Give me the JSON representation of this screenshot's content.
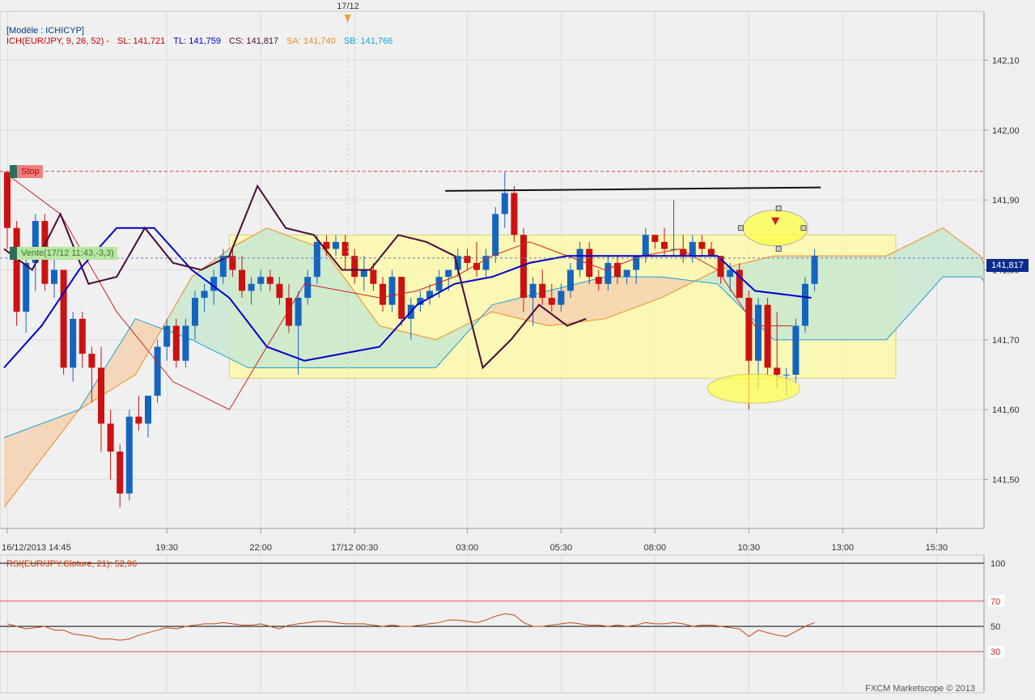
{
  "header": {
    "model": "[Modèle : ICHICYP]",
    "indicator": "ICH(EUR/JPY, 9, 26, 52) -",
    "sl": "SL: 141,721",
    "tl": "TL: 141,759",
    "cs": "CS: 141,817",
    "sa": "SA: 141,740",
    "sb": "SB: 141,766"
  },
  "top_marker": "17/12",
  "price_tag": "141,817",
  "stop_label": "Stop",
  "vente_label": "Vente(17/12 11:43,-3,3)",
  "rsi_label": "RSI(EUR/JPY.Cloture, 21): 52,96",
  "copyright": "FXCM Marketscope © 2013",
  "colors": {
    "bull": "#1565c0",
    "bear": "#cc1111",
    "tenkan": "#cc2222",
    "kijun": "#0000cc",
    "chikou": "#4a0a3a",
    "span_a": "#f08a24",
    "span_b": "#1aa0d8",
    "kumo_bull": "#c8e8d0",
    "kumo_bear": "#f5d2b0",
    "rect_fill": "#fffaa0"
  },
  "chart_data": [
    {
      "type": "candlestick",
      "title": "EUR/JPY",
      "x_ticks": [
        "16/12/2013 14:45",
        "19:30",
        "22:00",
        "17/12 00:30",
        "03:00",
        "05:30",
        "08:00",
        "10:30",
        "13:00",
        "15:30"
      ],
      "y_ticks": [
        "142,10",
        "142,00",
        "141,90",
        "141,80",
        "141,70",
        "141,60",
        "141,50"
      ],
      "ylim": [
        141.43,
        142.17
      ],
      "current_price": 141.817,
      "stop_level": 141.941,
      "candles": [
        [
          141.94,
          141.94,
          141.83,
          141.86
        ],
        [
          141.86,
          141.87,
          141.72,
          141.74
        ],
        [
          141.74,
          141.82,
          141.71,
          141.81
        ],
        [
          141.81,
          141.88,
          141.77,
          141.87
        ],
        [
          141.87,
          141.88,
          141.77,
          141.78
        ],
        [
          141.78,
          141.82,
          141.76,
          141.8
        ],
        [
          141.8,
          141.8,
          141.65,
          141.66
        ],
        [
          141.66,
          141.74,
          141.64,
          141.73
        ],
        [
          141.73,
          141.74,
          141.66,
          141.68
        ],
        [
          141.68,
          141.69,
          141.61,
          141.66
        ],
        [
          141.66,
          141.69,
          141.54,
          141.58
        ],
        [
          141.58,
          141.6,
          141.5,
          141.54
        ],
        [
          141.54,
          141.55,
          141.46,
          141.48
        ],
        [
          141.48,
          141.6,
          141.47,
          141.59
        ],
        [
          141.59,
          141.62,
          141.57,
          141.58
        ],
        [
          141.58,
          141.62,
          141.56,
          141.62
        ],
        [
          141.62,
          141.7,
          141.61,
          141.69
        ],
        [
          141.69,
          141.73,
          141.67,
          141.72
        ],
        [
          141.72,
          141.73,
          141.66,
          141.67
        ],
        [
          141.67,
          141.73,
          141.66,
          141.72
        ],
        [
          141.72,
          141.77,
          141.7,
          141.76
        ],
        [
          141.76,
          141.78,
          141.74,
          141.77
        ],
        [
          141.77,
          141.8,
          141.75,
          141.79
        ],
        [
          141.79,
          141.83,
          141.78,
          141.82
        ],
        [
          141.82,
          141.83,
          141.79,
          141.8
        ],
        [
          141.8,
          141.82,
          141.76,
          141.77
        ],
        [
          141.77,
          141.79,
          141.75,
          141.78
        ],
        [
          141.78,
          141.8,
          141.77,
          141.79
        ],
        [
          141.79,
          141.8,
          141.77,
          141.78
        ],
        [
          141.78,
          141.79,
          141.75,
          141.76
        ],
        [
          141.76,
          141.78,
          141.71,
          141.72
        ],
        [
          141.72,
          141.77,
          141.65,
          141.76
        ],
        [
          141.76,
          141.8,
          141.75,
          141.79
        ],
        [
          141.79,
          141.85,
          141.78,
          141.84
        ],
        [
          141.84,
          141.85,
          141.82,
          141.83
        ],
        [
          141.83,
          141.85,
          141.82,
          141.84
        ],
        [
          141.84,
          141.85,
          141.8,
          141.82
        ],
        [
          141.82,
          141.83,
          141.78,
          141.79
        ],
        [
          141.79,
          141.82,
          141.77,
          141.8
        ],
        [
          141.8,
          141.81,
          141.77,
          141.78
        ],
        [
          141.78,
          141.79,
          141.74,
          141.75
        ],
        [
          141.75,
          141.8,
          141.74,
          141.79
        ],
        [
          141.79,
          141.79,
          141.72,
          141.73
        ],
        [
          141.73,
          141.76,
          141.7,
          141.75
        ],
        [
          141.75,
          141.77,
          141.74,
          141.76
        ],
        [
          141.76,
          141.78,
          141.75,
          141.77
        ],
        [
          141.77,
          141.8,
          141.76,
          141.79
        ],
        [
          141.79,
          141.8,
          141.77,
          141.8
        ],
        [
          141.8,
          141.83,
          141.79,
          141.82
        ],
        [
          141.82,
          141.83,
          141.8,
          141.81
        ],
        [
          141.81,
          141.84,
          141.79,
          141.8
        ],
        [
          141.8,
          141.83,
          141.79,
          141.82
        ],
        [
          141.82,
          141.89,
          141.81,
          141.88
        ],
        [
          141.88,
          141.94,
          141.86,
          141.91
        ],
        [
          141.91,
          141.92,
          141.84,
          141.85
        ],
        [
          141.85,
          141.86,
          141.74,
          141.76
        ],
        [
          141.76,
          141.79,
          141.72,
          141.78
        ],
        [
          141.78,
          141.8,
          141.75,
          141.76
        ],
        [
          141.76,
          141.78,
          141.74,
          141.75
        ],
        [
          141.75,
          141.78,
          141.74,
          141.77
        ],
        [
          141.77,
          141.81,
          141.76,
          141.8
        ],
        [
          141.8,
          141.84,
          141.79,
          141.83
        ],
        [
          141.83,
          141.84,
          141.78,
          141.79
        ],
        [
          141.79,
          141.8,
          141.77,
          141.78
        ],
        [
          141.78,
          141.82,
          141.77,
          141.81
        ],
        [
          141.81,
          141.82,
          141.78,
          141.79
        ],
        [
          141.79,
          141.8,
          141.78,
          141.8
        ],
        [
          141.8,
          141.82,
          141.78,
          141.82
        ],
        [
          141.82,
          141.86,
          141.81,
          141.85
        ],
        [
          141.85,
          141.85,
          141.83,
          141.84
        ],
        [
          141.84,
          141.86,
          141.82,
          141.83
        ],
        [
          141.83,
          141.9,
          141.82,
          141.83
        ],
        [
          141.83,
          141.85,
          141.81,
          141.82
        ],
        [
          141.82,
          141.85,
          141.81,
          141.84
        ],
        [
          141.84,
          141.85,
          141.82,
          141.83
        ],
        [
          141.83,
          141.84,
          141.82,
          141.82
        ],
        [
          141.82,
          141.82,
          141.78,
          141.79
        ],
        [
          141.79,
          141.81,
          141.77,
          141.8
        ],
        [
          141.8,
          141.81,
          141.76,
          141.76
        ],
        [
          141.76,
          141.77,
          141.6,
          141.67
        ],
        [
          141.67,
          141.76,
          141.63,
          141.75
        ],
        [
          141.75,
          141.76,
          141.65,
          141.66
        ],
        [
          141.66,
          141.74,
          141.63,
          141.65
        ],
        [
          141.65,
          141.66,
          141.62,
          141.65
        ],
        [
          141.65,
          141.73,
          141.64,
          141.72
        ],
        [
          141.72,
          141.79,
          141.71,
          141.78
        ],
        [
          141.78,
          141.83,
          141.77,
          141.82
        ]
      ],
      "tenkan": [
        [
          0,
          141.94
        ],
        [
          6,
          141.88
        ],
        [
          12,
          141.74
        ],
        [
          18,
          141.64
        ],
        [
          24,
          141.6
        ],
        [
          28,
          141.69
        ],
        [
          32,
          141.78
        ],
        [
          36,
          141.77
        ],
        [
          40,
          141.76
        ],
        [
          44,
          141.77
        ],
        [
          48,
          141.79
        ],
        [
          52,
          141.82
        ],
        [
          56,
          141.84
        ],
        [
          60,
          141.82
        ],
        [
          64,
          141.8
        ],
        [
          68,
          141.82
        ],
        [
          72,
          141.83
        ],
        [
          76,
          141.8
        ],
        [
          80,
          141.72
        ],
        [
          84,
          141.72
        ]
      ],
      "kijun": [
        [
          0,
          141.66
        ],
        [
          4,
          141.72
        ],
        [
          8,
          141.8
        ],
        [
          12,
          141.86
        ],
        [
          16,
          141.86
        ],
        [
          20,
          141.8
        ],
        [
          24,
          141.76
        ],
        [
          28,
          141.69
        ],
        [
          32,
          141.67
        ],
        [
          36,
          141.68
        ],
        [
          40,
          141.69
        ],
        [
          44,
          141.75
        ],
        [
          48,
          141.78
        ],
        [
          52,
          141.79
        ],
        [
          56,
          141.81
        ],
        [
          60,
          141.82
        ],
        [
          64,
          141.82
        ],
        [
          70,
          141.82
        ],
        [
          76,
          141.82
        ],
        [
          80,
          141.77
        ],
        [
          86,
          141.76
        ]
      ],
      "chikou": [
        [
          0,
          141.83
        ],
        [
          3,
          141.8
        ],
        [
          6,
          141.88
        ],
        [
          9,
          141.78
        ],
        [
          12,
          141.79
        ],
        [
          15,
          141.86
        ],
        [
          18,
          141.81
        ],
        [
          21,
          141.8
        ],
        [
          24,
          141.82
        ],
        [
          27,
          141.92
        ],
        [
          30,
          141.86
        ],
        [
          33,
          141.85
        ],
        [
          36,
          141.8
        ],
        [
          39,
          141.8
        ],
        [
          42,
          141.85
        ],
        [
          45,
          141.84
        ],
        [
          48,
          141.82
        ],
        [
          51,
          141.66
        ],
        [
          54,
          141.7
        ],
        [
          57,
          141.75
        ],
        [
          60,
          141.72
        ],
        [
          62,
          141.73
        ]
      ],
      "senkou_span_a": [
        [
          0,
          141.46
        ],
        [
          8,
          141.6
        ],
        [
          14,
          141.65
        ],
        [
          20,
          141.79
        ],
        [
          24,
          141.83
        ],
        [
          28,
          141.86
        ],
        [
          34,
          141.83
        ],
        [
          40,
          141.72
        ],
        [
          46,
          141.7
        ],
        [
          52,
          141.74
        ],
        [
          58,
          141.72
        ],
        [
          64,
          141.73
        ],
        [
          70,
          141.76
        ],
        [
          76,
          141.8
        ],
        [
          82,
          141.82
        ],
        [
          88,
          141.82
        ],
        [
          94,
          141.82
        ],
        [
          100,
          141.86
        ],
        [
          104,
          141.82
        ],
        [
          106,
          141.76
        ]
      ],
      "senkou_span_b": [
        [
          0,
          141.56
        ],
        [
          8,
          141.6
        ],
        [
          14,
          141.73
        ],
        [
          20,
          141.7
        ],
        [
          26,
          141.66
        ],
        [
          32,
          141.66
        ],
        [
          40,
          141.66
        ],
        [
          46,
          141.66
        ],
        [
          52,
          141.75
        ],
        [
          58,
          141.77
        ],
        [
          64,
          141.79
        ],
        [
          70,
          141.79
        ],
        [
          76,
          141.78
        ],
        [
          82,
          141.7
        ],
        [
          88,
          141.7
        ],
        [
          94,
          141.7
        ],
        [
          100,
          141.79
        ],
        [
          104,
          141.79
        ],
        [
          106,
          141.76
        ]
      ],
      "rsi": {
        "label": "RSI(EUR/JPY.Cloture, 21)",
        "value": 52.96,
        "levels": [
          "100",
          "70",
          "50",
          "30"
        ],
        "values": [
          52,
          50,
          48,
          49,
          50,
          47,
          47,
          44,
          43,
          42,
          40,
          40,
          39,
          40,
          43,
          45,
          47,
          49,
          48,
          50,
          51,
          52,
          52,
          53,
          52,
          51,
          51,
          52,
          50,
          48,
          51,
          52,
          53,
          54,
          54,
          53,
          52,
          52,
          52,
          51,
          50,
          51,
          50,
          50,
          51,
          52,
          53,
          55,
          55,
          54,
          53,
          55,
          58,
          60,
          59,
          53,
          50,
          50,
          51,
          52,
          53,
          52,
          51,
          51,
          50,
          51,
          50,
          51,
          53,
          52,
          52,
          53,
          52,
          50,
          51,
          51,
          50,
          49,
          48,
          42,
          47,
          45,
          43,
          42,
          46,
          50,
          53
        ]
      }
    }
  ]
}
